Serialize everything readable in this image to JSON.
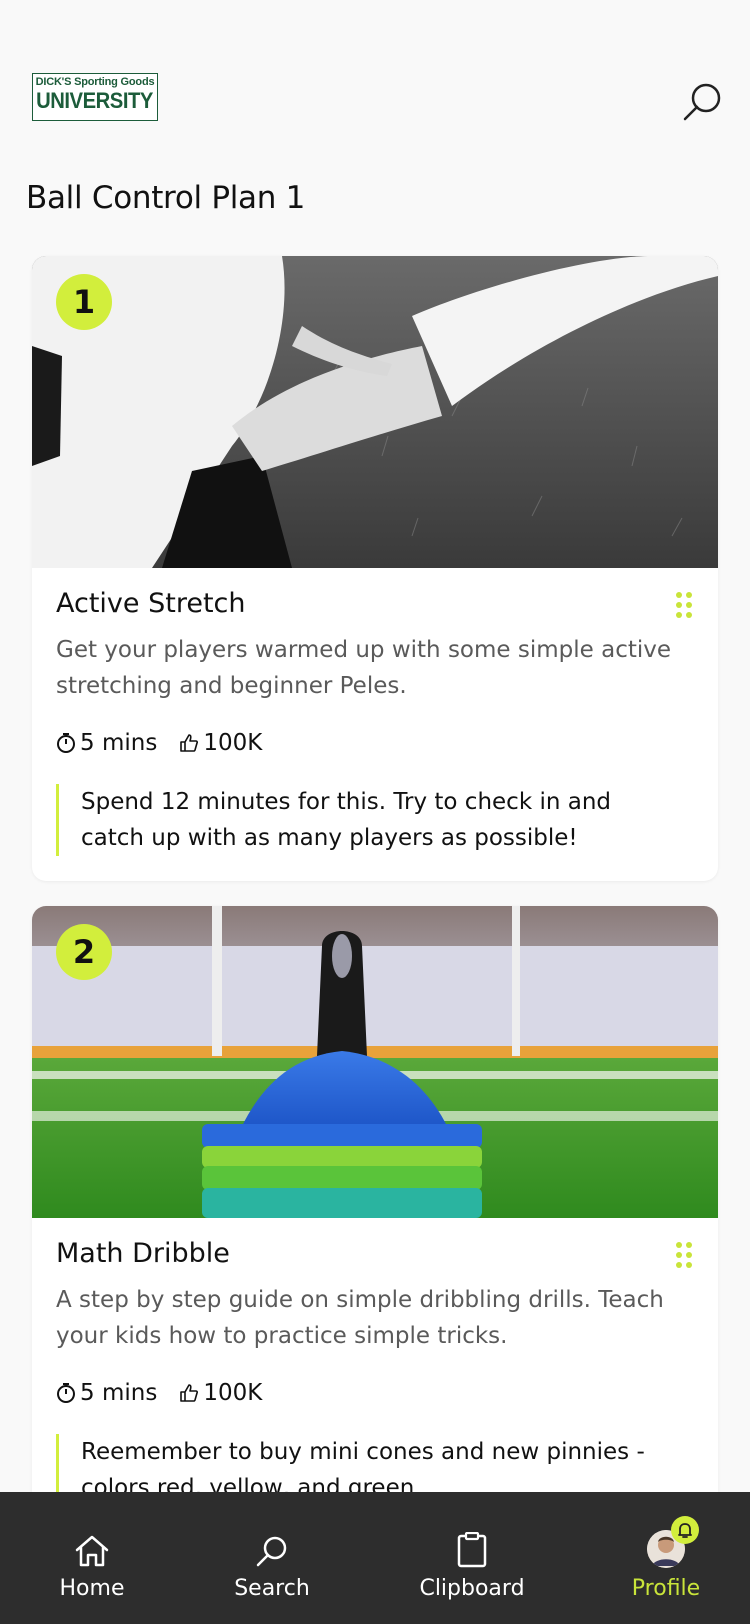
{
  "brand": {
    "logo_top": "DICK'S Sporting Goods",
    "logo_bottom": "UNIVERSITY",
    "color": "#1c5c3a"
  },
  "header": {
    "search_icon": "search-icon"
  },
  "page": {
    "title": "Ball Control Plan 1"
  },
  "cards": [
    {
      "number": "1",
      "title": "Active Stretch",
      "description": "Get your players warmed up with some simple active stretching and beginner Peles.",
      "duration": "5 mins",
      "likes": "100K",
      "note": "Spend 12 minutes for this. Try to check in and catch up with as many players as possible!",
      "image": "black-and-white photo of soccer player stretching on grass"
    },
    {
      "number": "2",
      "title": "Math Dribble",
      "description": "A step by step guide on simple dribbling drills. Teach your kids how to practice simple tricks.",
      "duration": "5 mins",
      "likes": "100K",
      "note": "Reemember to buy mini cones and new pinnies - colors red, yellow, and green.",
      "image": "stack of blue and green training cones on a soccer field"
    }
  ],
  "tabbar": {
    "items": [
      {
        "label": "Home",
        "icon": "home-icon"
      },
      {
        "label": "Search",
        "icon": "search-icon"
      },
      {
        "label": "Clipboard",
        "icon": "clipboard-icon"
      },
      {
        "label": "Profile",
        "icon": "avatar-icon"
      }
    ],
    "active": "Profile"
  },
  "colors": {
    "accent": "#d2ee3c",
    "tabbar_bg": "#2d2d2d",
    "active_tab": "#c9e43a"
  }
}
